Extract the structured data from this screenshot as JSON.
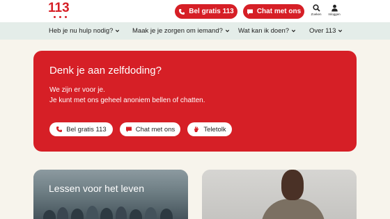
{
  "header": {
    "logo_text": "113",
    "call_button": "Bel gratis 113",
    "chat_button": "Chat met ons",
    "search_label": "Zoeken",
    "login_label": "Inloggen"
  },
  "nav": {
    "items": [
      {
        "label": "Heb je nu hulp nodig?"
      },
      {
        "label": "Maak je je zorgen om iemand?"
      },
      {
        "label": "Wat kan ik doen?"
      },
      {
        "label": "Over 113"
      }
    ]
  },
  "hero": {
    "title": "Denk je aan zelfdoding?",
    "line1": "We zijn er voor je.",
    "line2": "Je kunt met ons geheel anoniem bellen of chatten.",
    "buttons": [
      {
        "label": "Bel gratis 113",
        "icon": "phone-icon"
      },
      {
        "label": "Chat met ons",
        "icon": "chat-icon"
      },
      {
        "label": "Teletolk",
        "icon": "hand-icon"
      }
    ]
  },
  "cards": [
    {
      "title": "Lessen voor het leven"
    },
    {
      "title": ""
    }
  ],
  "colors": {
    "brand_red": "#d61f26",
    "nav_bg": "#e4ede9",
    "page_bg": "#f7f4ec"
  }
}
